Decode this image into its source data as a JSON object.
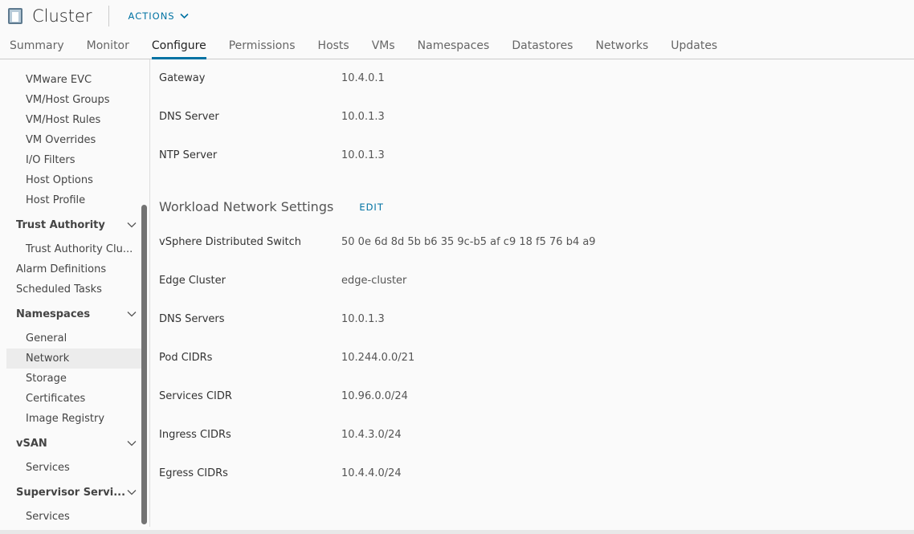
{
  "header": {
    "title": "Cluster",
    "actions_label": "ACTIONS"
  },
  "tabs": [
    "Summary",
    "Monitor",
    "Configure",
    "Permissions",
    "Hosts",
    "VMs",
    "Namespaces",
    "Datastores",
    "Networks",
    "Updates"
  ],
  "active_tab": "Configure",
  "sidebar": [
    {
      "label": "VMware EVC",
      "type": "child"
    },
    {
      "label": "VM/Host Groups",
      "type": "child"
    },
    {
      "label": "VM/Host Rules",
      "type": "child"
    },
    {
      "label": "VM Overrides",
      "type": "child"
    },
    {
      "label": "I/O Filters",
      "type": "child"
    },
    {
      "label": "Host Options",
      "type": "child"
    },
    {
      "label": "Host Profile",
      "type": "child"
    },
    {
      "label": "Trust Authority",
      "type": "group"
    },
    {
      "label": "Trust Authority Clu...",
      "type": "child"
    },
    {
      "label": "Alarm Definitions",
      "type": "top"
    },
    {
      "label": "Scheduled Tasks",
      "type": "top"
    },
    {
      "label": "Namespaces",
      "type": "group"
    },
    {
      "label": "General",
      "type": "child"
    },
    {
      "label": "Network",
      "type": "child",
      "selected": true
    },
    {
      "label": "Storage",
      "type": "child"
    },
    {
      "label": "Certificates",
      "type": "child"
    },
    {
      "label": "Image Registry",
      "type": "child"
    },
    {
      "label": "vSAN",
      "type": "group"
    },
    {
      "label": "Services",
      "type": "child"
    },
    {
      "label": "Supervisor Servi...",
      "type": "group"
    },
    {
      "label": "Services",
      "type": "child"
    }
  ],
  "management": [
    {
      "key": "Gateway",
      "value": "10.4.0.1"
    },
    {
      "key": "DNS Server",
      "value": "10.0.1.3"
    },
    {
      "key": "NTP Server",
      "value": "10.0.1.3"
    }
  ],
  "workload": {
    "title": "Workload Network Settings",
    "edit_label": "EDIT",
    "rows": [
      {
        "key": "vSphere Distributed Switch",
        "value": "50 0e 6d 8d 5b b6 35 9c-b5 af c9 18 f5 76 b4 a9"
      },
      {
        "key": "Edge Cluster",
        "value": "edge-cluster"
      },
      {
        "key": "DNS Servers",
        "value": "10.0.1.3"
      },
      {
        "key": "Pod CIDRs",
        "value": "10.244.0.0/21"
      },
      {
        "key": "Services CIDR",
        "value": "10.96.0.0/24"
      },
      {
        "key": "Ingress CIDRs",
        "value": "10.4.3.0/24"
      },
      {
        "key": "Egress CIDRs",
        "value": "10.4.4.0/24"
      }
    ]
  },
  "colors": {
    "accent": "#0072a3"
  }
}
